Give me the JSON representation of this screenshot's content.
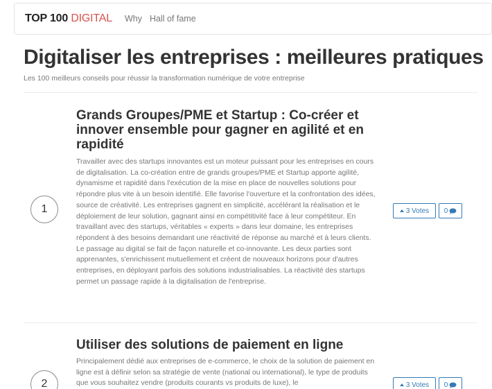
{
  "nav": {
    "brand_top": "TOP 100",
    "brand_digital": "DIGITAL",
    "links": [
      "Why",
      "Hall of fame"
    ]
  },
  "page": {
    "title": "Digitaliser les entreprises : meilleures pratiques",
    "subtitle": "Les 100 meilleurs conseils pour réussir la transformation numérique de votre entreprise"
  },
  "entries": [
    {
      "rank": "1",
      "title": "Grands Groupes/PME et Startup : Co-créer et innover ensemble pour gagner en agilité et en rapidité",
      "body": "Travailler avec des startups innovantes est un moteur puissant pour les entreprises en cours de digitalisation. La co-création entre de grands groupes/PME et Startup apporte agilité, dynamisme et rapidité dans l'exécution de la mise en place de nouvelles solutions pour répondre plus vite à un besoin identifié. Elle favorise l'ouverture et la confrontation des idées, source de créativité. Les entreprises gagnent en simplicité, accélérant la réalisation et le déploiement de leur solution, gagnant ainsi en compétitivité face à leur compétiteur. En travaillant avec des startups, véritables « experts » dans leur domaine, les entreprises répondent à des besoins demandant une réactivité de réponse au marché et à leurs clients. Le passage au digital se fait de façon naturelle et co-innovante. Les deux parties sont apprenantes, s'enrichissent mutuellement et créent de nouveaux horizons pour d'autres entreprises, en déployant parfois des solutions industrialisables. La réactivité des startups permet un passage rapide à la digitalisation de l'entreprise.",
      "votes": "3 Votes",
      "comments": "0"
    },
    {
      "rank": "2",
      "title": "Utiliser des solutions de paiement en ligne",
      "body": "Principalement dédié aux entreprises de e-commerce, le choix de la solution de paiement en ligne est à définir selon sa stratégie de vente (national ou international), le type de produits que vous souhaitez vendre (produits courants vs produits de luxe), le",
      "votes": "3 Votes",
      "comments": "0"
    }
  ],
  "colors": {
    "brand_accent": "#d9534f",
    "button_primary": "#337ab7"
  }
}
